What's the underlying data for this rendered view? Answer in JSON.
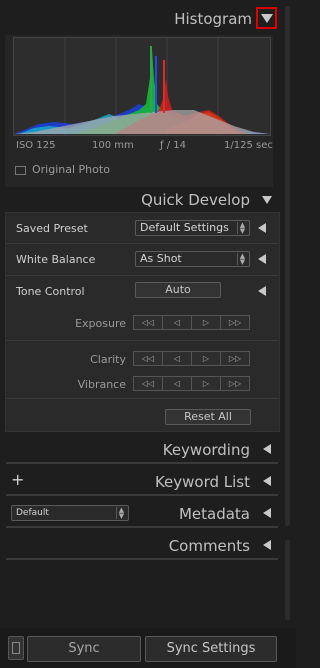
{
  "histogram": {
    "title": "Histogram",
    "iso": "ISO 125",
    "focal": "100 mm",
    "aperture": "ƒ / 14",
    "shutter": "1/125 sec",
    "original_photo": "Original Photo"
  },
  "quick_develop": {
    "title": "Quick Develop",
    "saved_preset_label": "Saved Preset",
    "saved_preset_value": "Default Settings",
    "white_balance_label": "White Balance",
    "white_balance_value": "As Shot",
    "tone_control_label": "Tone Control",
    "auto_label": "Auto",
    "exposure_label": "Exposure",
    "clarity_label": "Clarity",
    "vibrance_label": "Vibrance",
    "reset_all_label": "Reset All",
    "step_buttons": [
      "◁◁",
      "◁",
      "▷",
      "▷▷"
    ]
  },
  "keywording": {
    "title": "Keywording"
  },
  "keyword_list": {
    "title": "Keyword List",
    "add_symbol": "+"
  },
  "metadata": {
    "title": "Metadata",
    "preset_value": "Default"
  },
  "comments": {
    "title": "Comments"
  },
  "footer": {
    "sync_label": "Sync",
    "sync_settings_label": "Sync Settings"
  }
}
